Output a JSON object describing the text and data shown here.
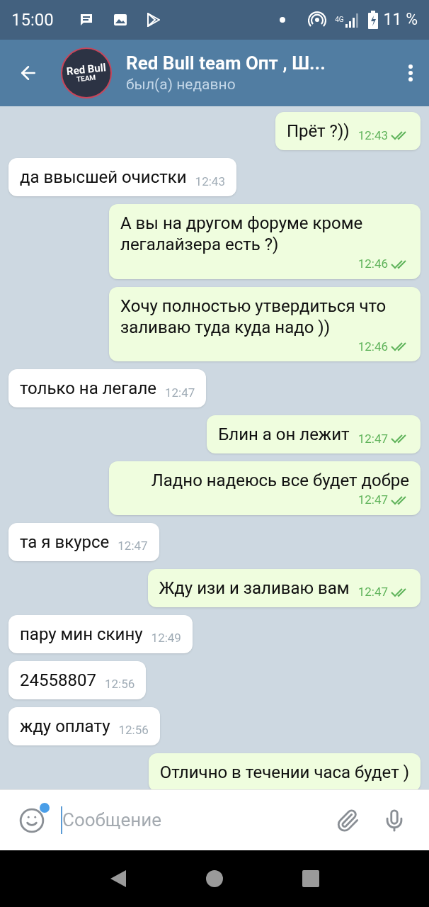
{
  "status_bar": {
    "time": "15:00",
    "battery": "11 %",
    "network": "4G"
  },
  "header": {
    "title": "Red Bull team Опт , Ш...",
    "status": "был(а) недавно",
    "avatar_text": [
      "Red Bull",
      "TEAM"
    ]
  },
  "messages": [
    {
      "kind": "out",
      "text": "Прёт ?))",
      "time": "12:43",
      "read": true
    },
    {
      "kind": "in",
      "text": "да ввысшей очистки",
      "time": "12:43"
    },
    {
      "kind": "out",
      "text": "А вы на другом форуме кроме легалайзера есть ?)",
      "time": "12:46",
      "read": true
    },
    {
      "kind": "out",
      "text": "Хочу полностью утвердиться что заливаю туда куда надо ))",
      "time": "12:46",
      "read": true
    },
    {
      "kind": "in",
      "text": "только на легале",
      "time": "12:47"
    },
    {
      "kind": "out",
      "text": "Блин а он лежит",
      "time": "12:47",
      "read": true
    },
    {
      "kind": "out",
      "text": "Ладно надеюсь все будет добре",
      "time": "12:47",
      "read": true
    },
    {
      "kind": "in",
      "text": "та я вкурсе",
      "time": "12:47"
    },
    {
      "kind": "out",
      "text": "Жду изи и заливаю вам",
      "time": "12:47",
      "read": true
    },
    {
      "kind": "in",
      "text": "пару мин скину",
      "time": "12:49"
    },
    {
      "kind": "in",
      "text": "24558807",
      "time": "12:56"
    },
    {
      "kind": "in",
      "text": "жду оплату",
      "time": "12:56"
    },
    {
      "kind": "out",
      "text": "Отлично в течении часа будет )"
    }
  ],
  "composer": {
    "placeholder": "Сообщение",
    "emoji_badge": true
  }
}
